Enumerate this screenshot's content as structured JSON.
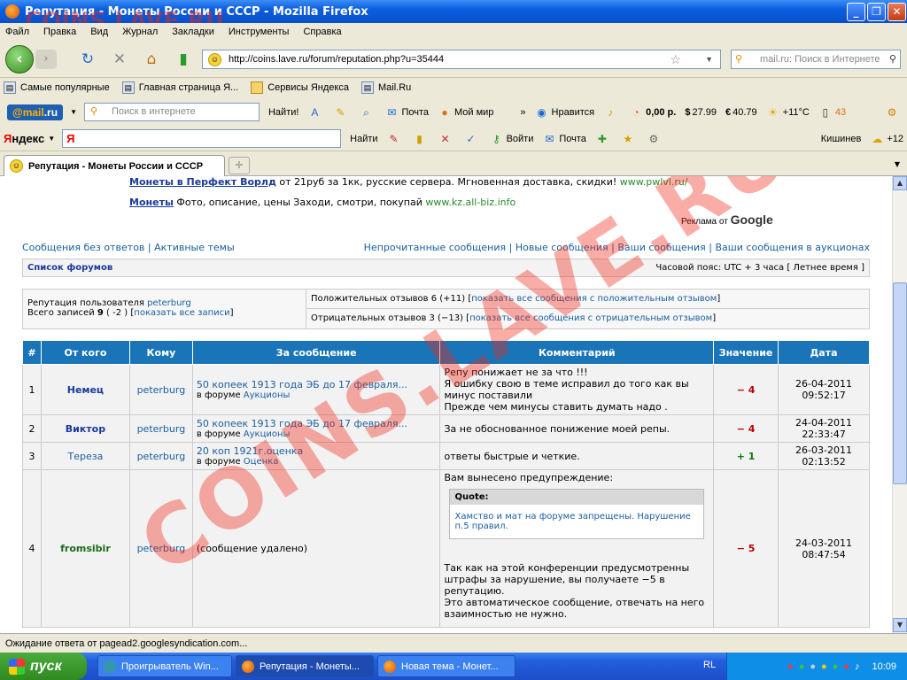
{
  "window": {
    "title": "Репутация - Монеты России и СССР - Mozilla Firefox"
  },
  "menu": [
    "Файл",
    "Правка",
    "Вид",
    "Журнал",
    "Закладки",
    "Инструменты",
    "Справка"
  ],
  "nav": {
    "url": "http://coins.lave.ru/forum/reputation.php?u=35444",
    "search_placeholder": "mail.ru: Поиск в Интернете"
  },
  "bookmarks": [
    "Самые популярные",
    "Главная страница Я...",
    "Сервисы Яндекса",
    "Mail.Ru"
  ],
  "mailbar": {
    "logo_left": "@mail",
    "logo_right": ".ru",
    "search_placeholder": "Поиск в интернете",
    "find": "Найти!",
    "mail": "Почта",
    "myworld": "Мой мир",
    "like": "Нравится",
    "balance": "0,00 р.",
    "usd": "27.99",
    "eur": "40.79",
    "weather": "+11°C",
    "count": "43"
  },
  "yandexbar": {
    "logo_y": "Я",
    "logo_rest": "ндекс",
    "search_letter": "Я",
    "find": "Найти",
    "login": "Войти",
    "mail": "Почта",
    "city": "Кишинев",
    "temp": "+12"
  },
  "tab": {
    "title": "Репутация - Монеты России и СССР"
  },
  "ads": [
    {
      "title": "Монеты в Перфект Ворлд",
      "text": "от 21руб за 1кк, русские сервера. Мгновенная доставка, скидки!",
      "url": "www.pwlvl.ru/"
    },
    {
      "title": "Монеты",
      "text": "Фото, описание, цены Заходи, смотри, покупай",
      "url": "www.kz.all-biz.info"
    }
  ],
  "ads_by": "Реклама от",
  "ads_google": "Google",
  "links_left": [
    "Сообщения без ответов",
    "Активные темы"
  ],
  "links_right": [
    "Непрочитанные сообщения",
    "Новые сообщения",
    "Ваши сообщения",
    "Ваши сообщения в аукционах"
  ],
  "forum_list": "Список форумов",
  "timezone": "Часовой пояс: UTC + 3 часа [ Летнее время ]",
  "reputation": {
    "user_label": "Репутация пользователя",
    "user": "peterburg",
    "total_label": "Всего записей",
    "total": "9",
    "total_score": "( -2 )",
    "show_all": "показать все записи",
    "positive": "Положительных отзывов 6 (+11)",
    "positive_link": "показать все сообщения с положительным отзывом",
    "negative": "Отрицательных отзывов 3 (−13)",
    "negative_link": "показать все сообщения с отрицательным отзывом"
  },
  "columns": [
    "#",
    "От кого",
    "Кому",
    "За сообщение",
    "Комментарий",
    "Значение",
    "Дата"
  ],
  "rows": [
    {
      "n": "1",
      "from": "Немец",
      "to": "peterburg",
      "post": "50 копеек 1913 года ЭБ до 17 февраля...",
      "forum_in": "в форуме",
      "forum": "Аукционы",
      "comment": [
        "Репу понижает не за что !!!",
        "Я ошибку свою в теме исправил до того как вы минус поставили",
        "Прежде чем минусы ставить думать надо ."
      ],
      "value": "− 4",
      "date": "26-04-2011",
      "time": "09:52:17"
    },
    {
      "n": "2",
      "from": "Виктор",
      "to": "peterburg",
      "post": "50 копеек 1913 года ЭБ до 17 февраля...",
      "forum_in": "в форуме",
      "forum": "Аукционы",
      "comment": [
        "За не обоснованное понижение моей репы."
      ],
      "value": "− 4",
      "date": "24-04-2011",
      "time": "22:33:47"
    },
    {
      "n": "3",
      "from": "Тереза",
      "to": "peterburg",
      "post": "20 коп 1921г.оценка",
      "forum_in": "в форуме",
      "forum": "Оценка",
      "comment": [
        "ответы быстрые и четкие."
      ],
      "value": "+ 1",
      "date": "26-03-2011",
      "time": "02:13:52"
    },
    {
      "n": "4",
      "from": "fromsibir",
      "to": "peterburg",
      "post": "(сообщение удалено)",
      "comment_pre": "Вам вынесено предупреждение:",
      "quote_title": "Quote:",
      "quote_text": "Хамство и мат на форуме запрещены. Нарушение п.5 правил.",
      "comment": [
        "Так как на этой конференции предусмотренны штрафы за нарушение, вы получаете −5 в репутацию.",
        "Это автоматическое сообщение, отвечать на него взаимностью не нужно."
      ],
      "value": "− 5",
      "date": "24-03-2011",
      "time": "08:47:54"
    }
  ],
  "status": "Ожидание ответа от pagead2.googlesyndication.com...",
  "taskbar": {
    "start": "пуск",
    "tasks": [
      "Проигрыватель Win...",
      "Репутация - Монеты...",
      "Новая тема - Монет..."
    ],
    "lang": "RL",
    "clock": "10:09"
  },
  "watermark": "COINS.LAVE.RU",
  "colors": {
    "header": "#1975b8",
    "negative": "#bb0000",
    "positive": "#0a7a0a",
    "watermark": "#f02814"
  }
}
